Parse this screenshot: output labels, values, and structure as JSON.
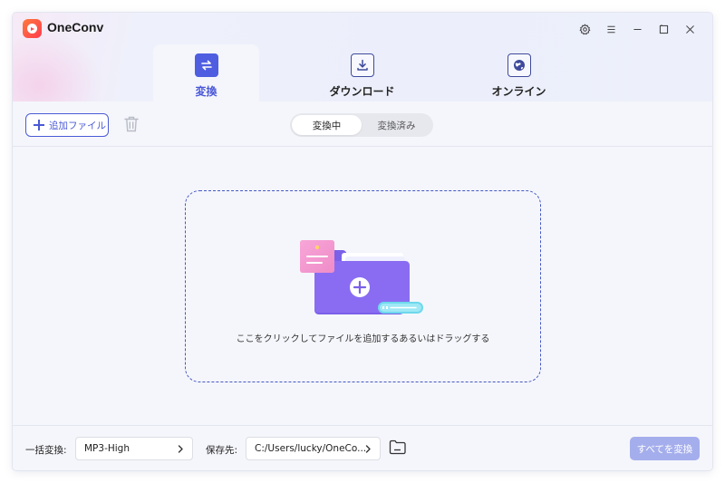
{
  "app": {
    "title": "OneConv",
    "logo_icon": "play-circle-logo",
    "brand_colors": {
      "logo_start": "#ff7a3d",
      "logo_end": "#ff3b4e",
      "accent": "#4a5ad6"
    }
  },
  "window_controls": [
    {
      "name": "settings",
      "icon": "gear-icon"
    },
    {
      "name": "menu",
      "icon": "hamburger-icon"
    },
    {
      "name": "minimize",
      "icon": "minimize-icon"
    },
    {
      "name": "maximize",
      "icon": "maximize-icon"
    },
    {
      "name": "close",
      "icon": "close-icon"
    }
  ],
  "tabs": [
    {
      "label": "変換",
      "icon": "convert-arrows-icon",
      "active": true
    },
    {
      "label": "ダウンロード",
      "icon": "download-icon",
      "active": false
    },
    {
      "label": "オンライン",
      "icon": "globe-icon",
      "active": false
    }
  ],
  "toolbar": {
    "add_file_label": "追加ファイル",
    "delete_icon": "trash-icon",
    "segments": [
      {
        "label": "変換中",
        "selected": true
      },
      {
        "label": "変換済み",
        "selected": false
      }
    ]
  },
  "dropzone": {
    "hint": "ここをクリックしてファイルを追加するあるいはドラッグする",
    "illustration_icon": "folder-add-icon"
  },
  "footer": {
    "batch_label": "一括変換:",
    "format_value": "MP3-High",
    "save_label": "保存先:",
    "save_path": "C:/Users/lucky/OneCo...",
    "open_folder_icon": "folder-icon",
    "convert_all_label": "すべてを変換",
    "convert_all_enabled": false
  }
}
